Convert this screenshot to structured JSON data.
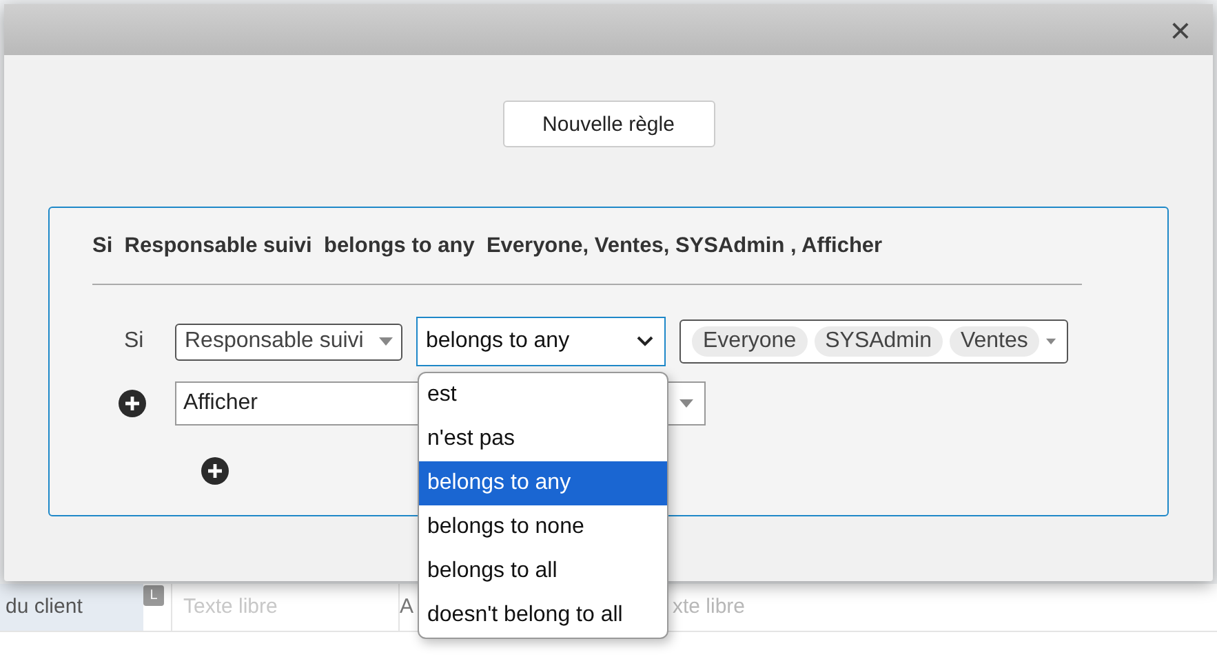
{
  "background_row": {
    "label": "du client",
    "badge": "L",
    "cells": [
      "Texte libre",
      "A",
      "xte libre"
    ]
  },
  "dialog": {
    "close": "×",
    "new_rule_button": "Nouvelle règle",
    "rule": {
      "summary": "Si  Responsable suivi  belongs to any  Everyone, Ventes, SYSAdmin , Afficher",
      "condition_label": "Si",
      "field": "Responsable suivi",
      "operator": "belongs to any",
      "values": [
        "Everyone",
        "SYSAdmin",
        "Ventes"
      ],
      "action": "Afficher",
      "operator_options": [
        {
          "label": "est",
          "selected": false
        },
        {
          "label": "n'est pas",
          "selected": false
        },
        {
          "label": "belongs to any",
          "selected": true
        },
        {
          "label": "belongs to none",
          "selected": false
        },
        {
          "label": "belongs to all",
          "selected": false
        },
        {
          "label": "doesn't belong to all",
          "selected": false
        }
      ]
    }
  }
}
